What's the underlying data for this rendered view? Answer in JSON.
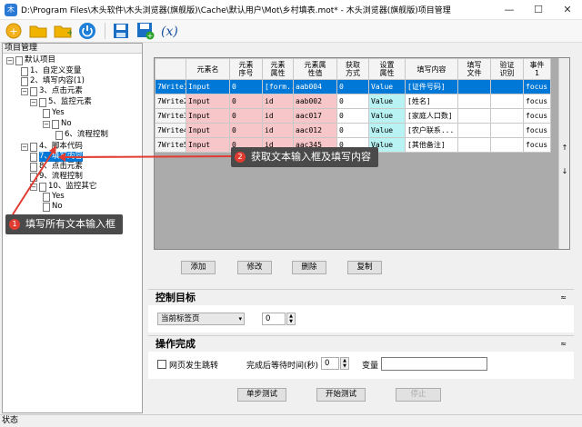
{
  "window": {
    "title": "D:\\Program Files\\木头软件\\木头浏览器(旗舰版)\\Cache\\默认用户\\Mot\\乡村填表.mot* - 木头浏览器(旗舰版)项目管理"
  },
  "left_panel": {
    "title": "项目管理",
    "tree": [
      {
        "label": "默认项目",
        "expander": "−"
      },
      {
        "label": "1、自定义变量"
      },
      {
        "label": "2、填写内容(1)"
      },
      {
        "label": "3、点击元素",
        "expander": "−"
      },
      {
        "label": "5、监控元素",
        "expander": "−"
      },
      {
        "label": "Yes"
      },
      {
        "label": "No",
        "expander": "−"
      },
      {
        "label": "6、流程控制"
      },
      {
        "label": "4、脚本代码",
        "expander": "−"
      },
      {
        "label": "7、填写内容"
      },
      {
        "label": "8、点击元素"
      },
      {
        "label": "9、流程控制"
      },
      {
        "label": "10、监控其它",
        "expander": "−"
      },
      {
        "label": "Yes"
      },
      {
        "label": "No"
      }
    ]
  },
  "grid": {
    "columns": [
      "",
      "元素名",
      "元素\n序号",
      "元素\n属性",
      "元素属\n性值",
      "获取\n方式",
      "设置\n属性",
      "填写内容",
      "填写\n文件",
      "验证\n识别",
      "事件\n1"
    ],
    "rows": [
      [
        "7Write1",
        "Input",
        "0",
        "[form...",
        "aab004",
        "0",
        "Value",
        "[证件号码]",
        "",
        "",
        "focus"
      ],
      [
        "7Write2",
        "Input",
        "0",
        "id",
        "aab002",
        "0",
        "Value",
        "[姓名]",
        "",
        "",
        "focus"
      ],
      [
        "7Write3",
        "Input",
        "0",
        "id",
        "aac017",
        "0",
        "Value",
        "[家庭人口数]",
        "",
        "",
        "focus"
      ],
      [
        "7Write4",
        "Input",
        "0",
        "id",
        "aac012",
        "0",
        "Value",
        "[农户联系...",
        "",
        "",
        "focus"
      ],
      [
        "7Write5",
        "Input",
        "0",
        "id",
        "aac345",
        "0",
        "Value",
        "[其他备注]",
        "",
        "",
        "focus"
      ]
    ],
    "scroll_up": "↑",
    "scroll_down": "↓"
  },
  "buttons": {
    "add": "添加",
    "edit": "修改",
    "delete": "删除",
    "copy": "复制"
  },
  "control_target": {
    "title": "控制目标",
    "chevron": "≈",
    "tab_select": "当前标签页",
    "tab_number": "0"
  },
  "operation_done": {
    "title": "操作完成",
    "chevron": "≈",
    "jump_label": "网页发生跳转",
    "wait_label": "完成后等待时间(秒)",
    "wait_value": "0",
    "variable_label": "变量",
    "variable_value": ""
  },
  "actions": {
    "single_step": "单步测试",
    "start": "开始测试",
    "stop": "停止"
  },
  "status": {
    "text": "状态"
  },
  "annotations": {
    "callout1": {
      "num": "1",
      "text": "填写所有文本输入框"
    },
    "callout2": {
      "num": "2",
      "text": "获取文本输入框及填写内容"
    }
  },
  "colors": {
    "selection": "#0078d7",
    "pink_cell": "#f7c6c9",
    "cyan_cell": "#b8f2f2",
    "callout_bg": "#4a4a4a",
    "callout_num": "#e03c31"
  },
  "icons": [
    "new-project-icon",
    "open-folder-icon",
    "add-folder-icon",
    "power-icon",
    "save-icon",
    "save-as-icon",
    "variable-icon"
  ]
}
